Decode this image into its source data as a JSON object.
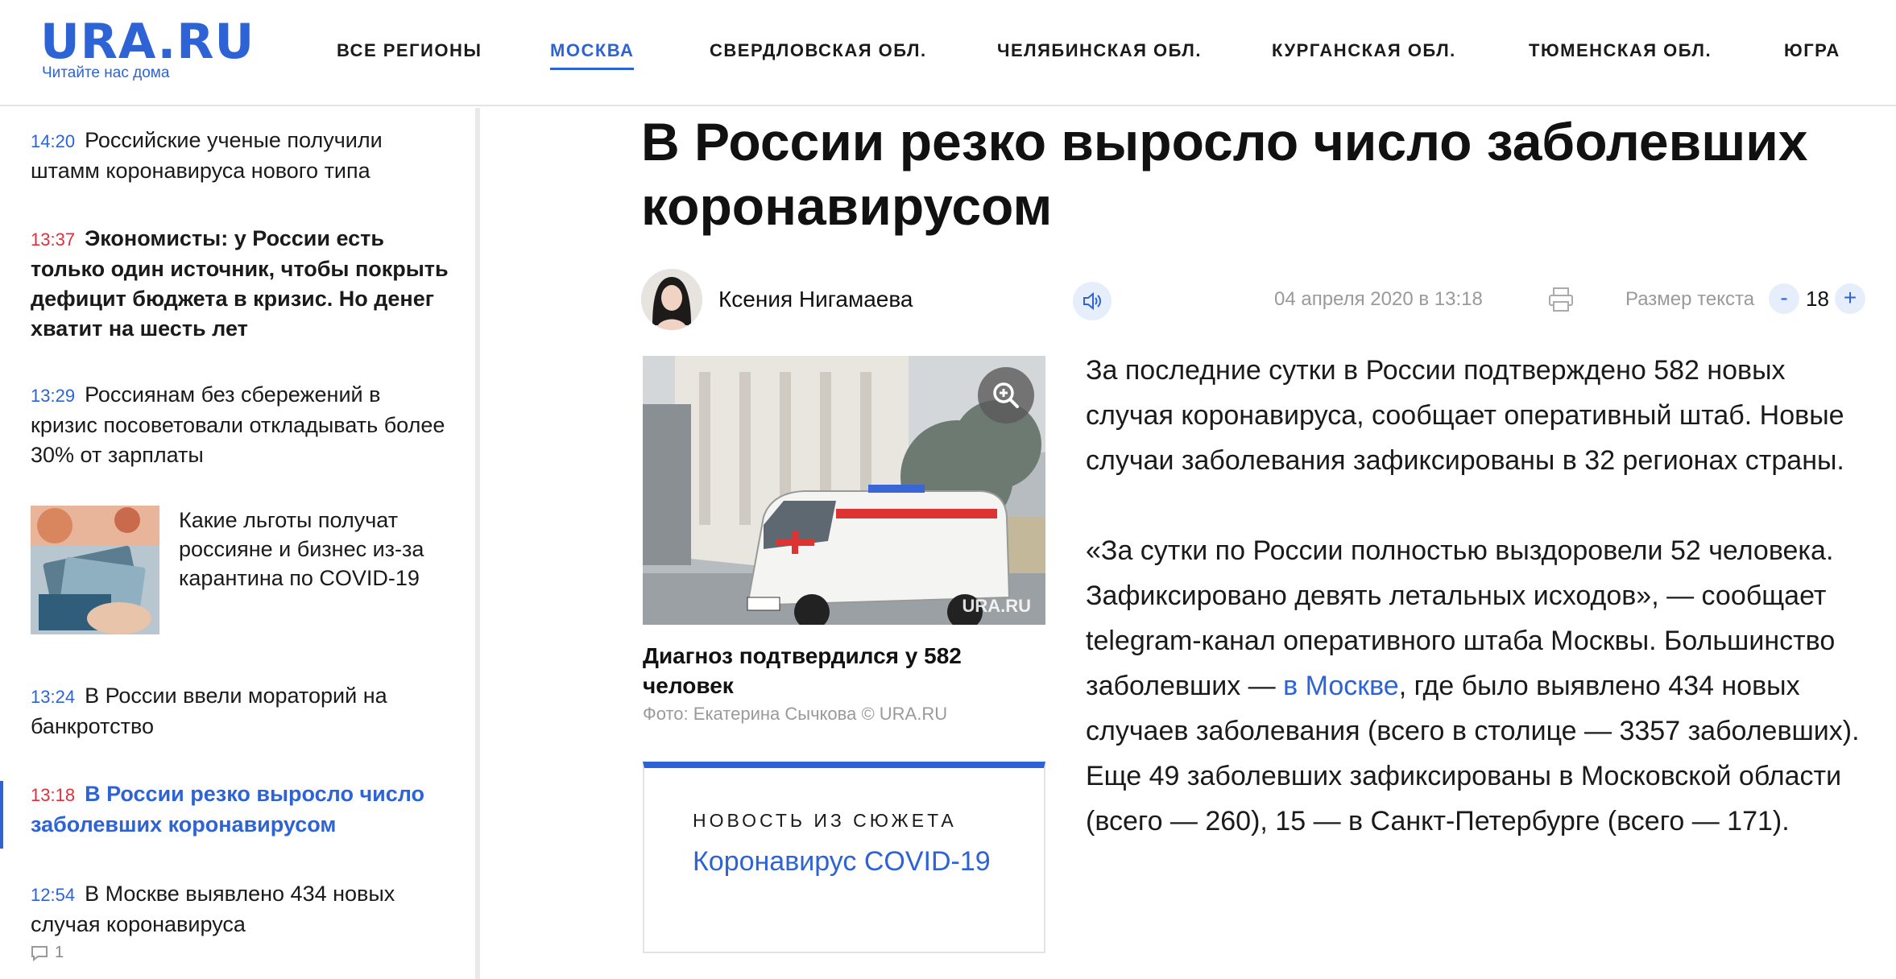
{
  "header": {
    "logo_text": "URA.RU",
    "logo_sub": "Читайте нас дома",
    "nav": [
      {
        "label": "ВСЕ РЕГИОНЫ",
        "active": false
      },
      {
        "label": "МОСКВА",
        "active": true
      },
      {
        "label": "СВЕРДЛОВСКАЯ ОБЛ.",
        "active": false
      },
      {
        "label": "ЧЕЛЯБИНСКАЯ ОБЛ.",
        "active": false
      },
      {
        "label": "КУРГАНСКАЯ ОБЛ.",
        "active": false
      },
      {
        "label": "ТЮМЕНСКАЯ ОБЛ.",
        "active": false
      },
      {
        "label": "ЮГРА",
        "active": false
      }
    ]
  },
  "sidebar": {
    "items": [
      {
        "time": "14:20",
        "title": "Российские ученые получили штамм коронавируса нового типа"
      },
      {
        "time": "13:37",
        "title": "Экономисты: у России есть только один источник, чтобы покрыть дефицит бюджета в кризис. Но денег хватит на шесть лет"
      },
      {
        "time": "13:29",
        "title": "Россиянам без сбережений в кризис посоветовали откладывать более 30% от зарплаты"
      },
      {
        "time": "",
        "title": "Какие льготы получат россияне и бизнес из-за карантина по COVID-19"
      },
      {
        "time": "13:24",
        "title": "В России ввели мораторий на банкротство"
      },
      {
        "time": "13:18",
        "title": "В России резко выросло число заболевших коронавирусом"
      },
      {
        "time": "12:54",
        "title": "В Москве выявлено 434 новых случая коронавируса"
      }
    ],
    "comment_count": "1"
  },
  "article": {
    "title": "В России резко выросло число заболевших коронавирусом",
    "author": "Ксения Нигамаева",
    "date": "04 апреля 2020 в 13:18",
    "text_size_label": "Размер текста",
    "text_size_value": "18",
    "minus": "-",
    "plus": "+",
    "photo_watermark": "URA.RU",
    "photo_caption": "Диагноз подтвердился у 582 человек",
    "photo_credit": "Фото: Екатерина Сычкова © URA.RU",
    "story_label": "НОВОСТЬ ИЗ СЮЖЕТА",
    "story_link": "Коронавирус COVID-19",
    "p1": "За последние сутки в России подтверждено 582 новых случая коронавируса, сообщает оперативный штаб. Новые случаи заболевания зафиксированы в 32 регионах страны.",
    "p2_a": "«За сутки по России полностью выздоровели 52 человека. Зафиксировано девять летальных исходов», — сообщает telegram-канал оперативного штаба Москвы. Большинство заболевших — ",
    "p2_link": "в Москве",
    "p2_b": ", где было выявлено 434 новых случаев заболевания (всего в столице — 3357 заболевших). Еще 49 заболевших зафиксированы в Московской области (всего — 260), 15 — в Санкт-Петербурге (всего — 171)."
  },
  "colors": {
    "accent": "#2e63d6",
    "red": "#e0303b",
    "muted": "#9a9a9a"
  }
}
